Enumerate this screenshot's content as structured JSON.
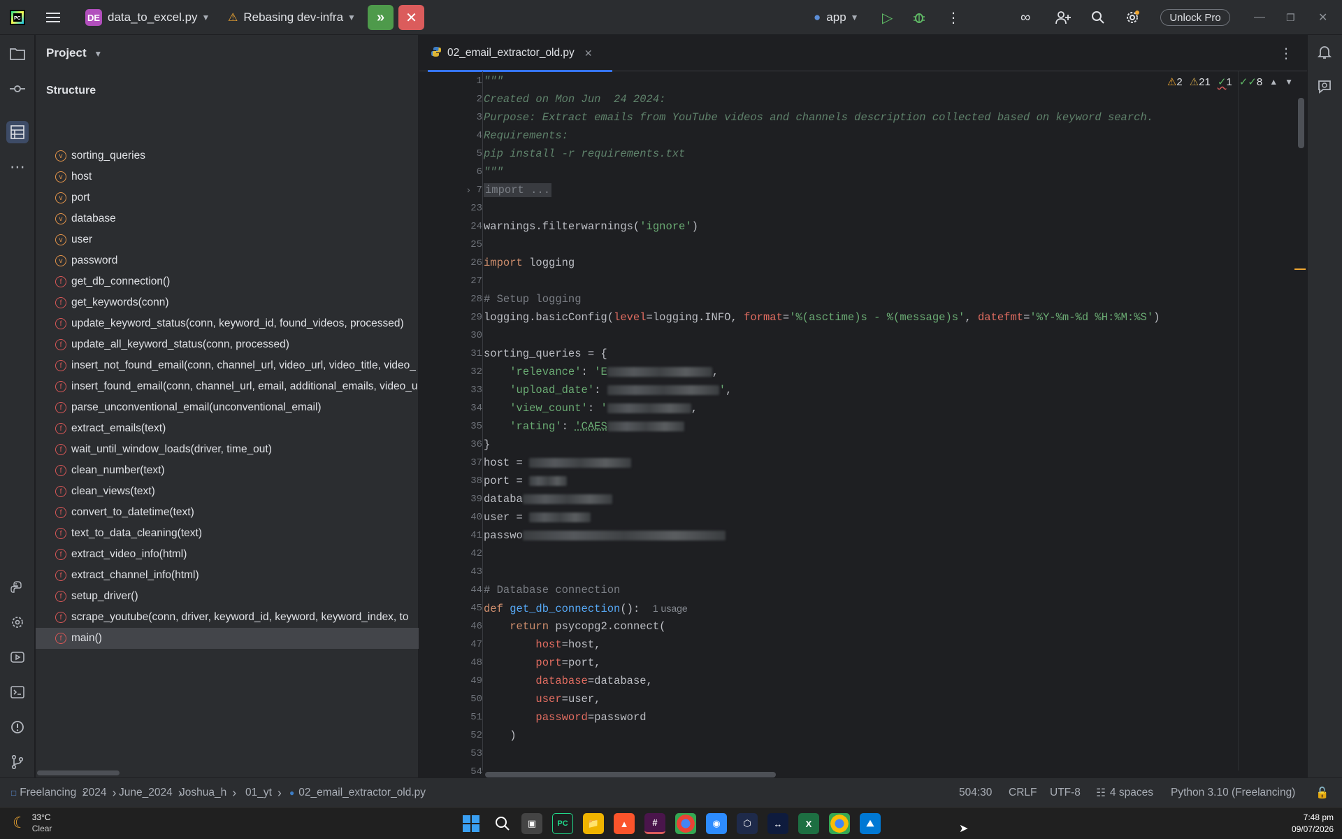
{
  "titlebar": {
    "project_initials": "DE",
    "project_name": "data_to_excel.py",
    "vcs_status": "Rebasing dev-infra",
    "run_config": "app",
    "unlock_label": "Unlock Pro"
  },
  "project_panel": {
    "title": "Project",
    "structure_title": "Structure",
    "items": [
      {
        "kind": "v",
        "label": "sorting_queries"
      },
      {
        "kind": "v",
        "label": "host"
      },
      {
        "kind": "v",
        "label": "port"
      },
      {
        "kind": "v",
        "label": "database"
      },
      {
        "kind": "v",
        "label": "user"
      },
      {
        "kind": "v",
        "label": "password"
      },
      {
        "kind": "f",
        "label": "get_db_connection()"
      },
      {
        "kind": "f",
        "label": "get_keywords(conn)"
      },
      {
        "kind": "f",
        "label": "update_keyword_status(conn, keyword_id, found_videos, processed)"
      },
      {
        "kind": "f",
        "label": "update_all_keyword_status(conn, processed)"
      },
      {
        "kind": "f",
        "label": "insert_not_found_email(conn, channel_url, video_url, video_title, video_"
      },
      {
        "kind": "f",
        "label": "insert_found_email(conn, channel_url, email, additional_emails, video_u"
      },
      {
        "kind": "f",
        "label": "parse_unconventional_email(unconventional_email)"
      },
      {
        "kind": "f",
        "label": "extract_emails(text)"
      },
      {
        "kind": "f",
        "label": "wait_until_window_loads(driver, time_out)"
      },
      {
        "kind": "f",
        "label": "clean_number(text)"
      },
      {
        "kind": "f",
        "label": "clean_views(text)"
      },
      {
        "kind": "f",
        "label": "convert_to_datetime(text)"
      },
      {
        "kind": "f",
        "label": "text_to_data_cleaning(text)"
      },
      {
        "kind": "f",
        "label": "extract_video_info(html)"
      },
      {
        "kind": "f",
        "label": "extract_channel_info(html)"
      },
      {
        "kind": "f",
        "label": "setup_driver()"
      },
      {
        "kind": "f",
        "label": "scrape_youtube(conn, driver, keyword_id, keyword, keyword_index, to"
      },
      {
        "kind": "f",
        "label": "main()"
      }
    ]
  },
  "editor": {
    "tab_name": "02_email_extractor_old.py",
    "inspections": {
      "warnings": "2",
      "weak_warnings": "21",
      "typos": "1",
      "ok": "8"
    },
    "line_numbers": [
      "1",
      "2",
      "3",
      "4",
      "5",
      "6",
      "7",
      "23",
      "24",
      "25",
      "26",
      "27",
      "28",
      "29",
      "30",
      "31",
      "32",
      "33",
      "34",
      "35",
      "36",
      "37",
      "38",
      "39",
      "40",
      "41",
      "42",
      "43",
      "44",
      "45",
      "46",
      "47",
      "48",
      "49",
      "50",
      "51",
      "52",
      "53",
      "54"
    ],
    "lines": {
      "l1": "\"\"\"",
      "l2": "Created on Mon Jun  24 2024:",
      "l3": "Purpose: Extract emails from YouTube videos and channels description collected based on keyword search.",
      "l4": "Requirements:",
      "l5": "pip install -r requirements.txt",
      "l6": "\"\"\"",
      "l7": "import ...",
      "l24_a": "warnings.filterwarnings(",
      "l24_b": "'ignore'",
      "l24_c": ")",
      "l26_kw": "import",
      "l26_rest": " logging",
      "l28": "# Setup logging",
      "l29_a": "logging.basicConfig(",
      "l29_p1": "level",
      "l29_b": "=logging.INFO, ",
      "l29_p2": "format",
      "l29_c": "=",
      "l29_s1": "'%(asctime)s - %(message)s'",
      "l29_d": ", ",
      "l29_p3": "datefmt",
      "l29_e": "=",
      "l29_s2": "'%Y-%m-%d %H:%M:%S'",
      "l29_f": ")",
      "l31": "sorting_queries = {",
      "l32": "'relevance'",
      "l32_v": "'E",
      "l33": "'upload_date'",
      "l34": "'view_count'",
      "l34_v": "'",
      "l35": "'rating'",
      "l35_v": "'CAES",
      "l36": "}",
      "l37": "host = ",
      "l38": "port = ",
      "l39": "databa",
      "l40": "user = ",
      "l41": "passwo",
      "l44": "# Database connection",
      "l45_kw": "def",
      "l45_fn": "get_db_connection",
      "l45_rest": "():",
      "l45_hint": "1 usage",
      "l46_kw": "return",
      "l46_rest": " psycopg2.connect(",
      "l47_p": "host",
      "l47_r": "=host,",
      "l48_p": "port",
      "l48_r": "=port,",
      "l49_p": "database",
      "l49_r": "=database,",
      "l50_p": "user",
      "l50_r": "=user,",
      "l51_p": "password",
      "l51_r": "=password",
      "l52": ")"
    }
  },
  "statusbar": {
    "breadcrumbs": [
      "Freelancing",
      "2024",
      "June_2024",
      "Joshua_h",
      "01_yt",
      "02_email_extractor_old.py"
    ],
    "position": "504:30",
    "line_sep": "CRLF",
    "encoding": "UTF-8",
    "indent": "4 spaces",
    "interpreter": "Python 3.10 (Freelancing)"
  },
  "taskbar": {
    "temp": "33°C",
    "condition": "Clear",
    "time": "7:48 pm",
    "date": "09/07/2026"
  }
}
